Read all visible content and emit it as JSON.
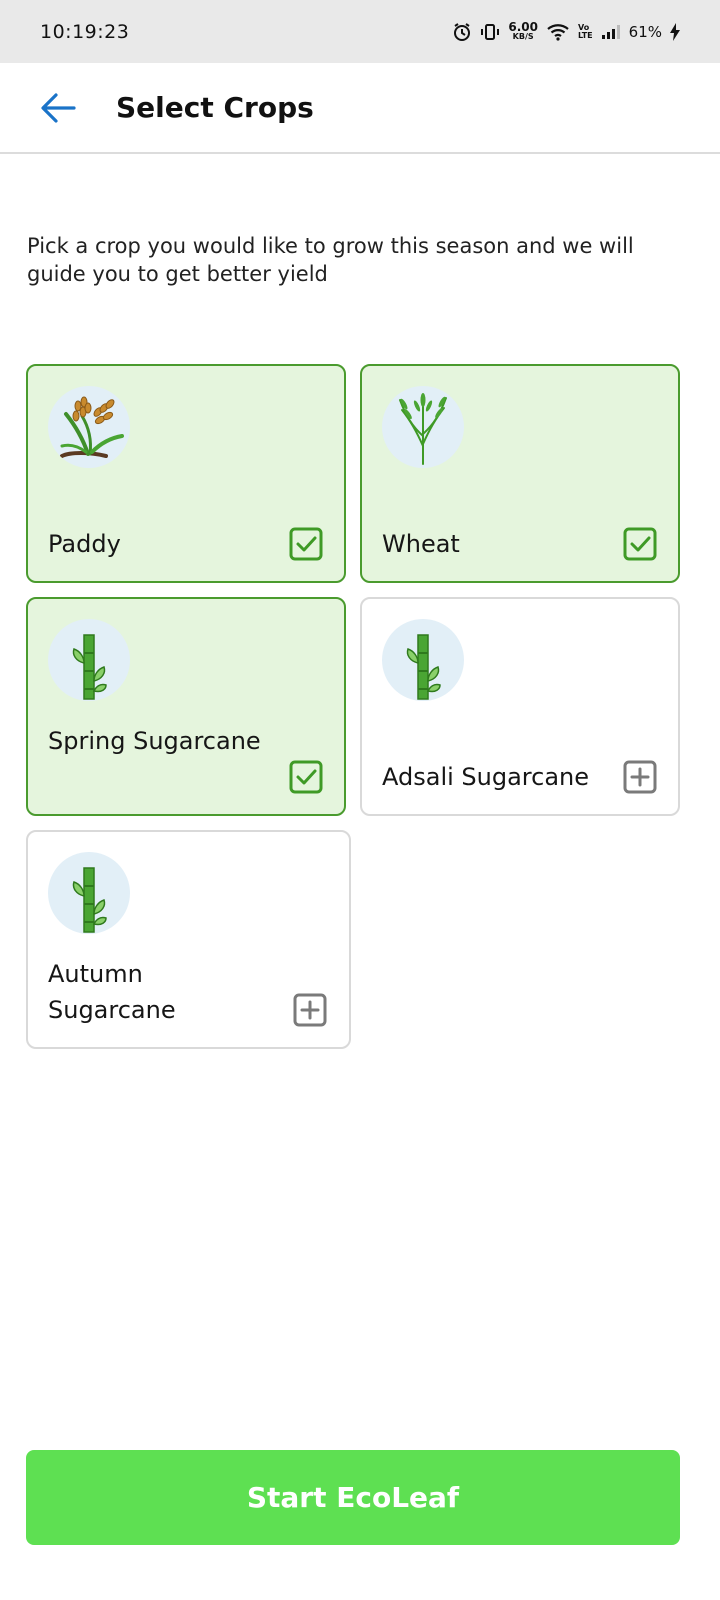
{
  "status_bar": {
    "time": "10:19:23",
    "net_speed": "6.00",
    "net_unit": "KB/S",
    "volte_top": "Vo",
    "volte_bottom": "LTE",
    "battery": "61%"
  },
  "header": {
    "title": "Select Crops"
  },
  "description": "Pick a crop you would like to grow this season and we will guide you to get better yield",
  "crops": [
    {
      "label": "Paddy",
      "selected": true,
      "icon": "paddy-icon"
    },
    {
      "label": "Wheat",
      "selected": true,
      "icon": "wheat-icon"
    },
    {
      "label": "Spring Sugarcane",
      "selected": true,
      "icon": "sugarcane-icon"
    },
    {
      "label": "Adsali Sugarcane",
      "selected": false,
      "icon": "sugarcane-icon"
    },
    {
      "label": "Autumn\nSugarcane",
      "selected": false,
      "icon": "sugarcane-icon"
    }
  ],
  "start_button": "Start EcoLeaf",
  "colors": {
    "selected_bg": "#e5f5dd",
    "selected_border": "#4a9b2e",
    "check_green": "#3f9a26",
    "plus_gray": "#7a7a7a",
    "button_green": "#5ee052",
    "back_arrow_blue": "#1a73c8"
  }
}
